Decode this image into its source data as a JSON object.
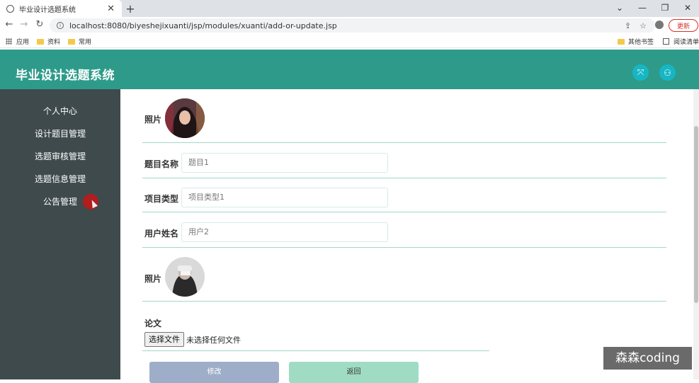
{
  "browser": {
    "tab_title": "毕业设计选题系统",
    "tab_close": "✕",
    "new_tab": "+",
    "url": "localhost:8080/biyeshejixuanti/jsp/modules/xuanti/add-or-update.jsp",
    "update_label": "更新",
    "window_controls": [
      "⌄",
      "—",
      "❐",
      "✕"
    ],
    "bookmarks": [
      {
        "label": "应用",
        "icon": "apps-grid-icon"
      },
      {
        "label": "资料",
        "icon": "folder-icon"
      },
      {
        "label": "常用",
        "icon": "folder-icon"
      }
    ],
    "bookmarks_right": [
      {
        "label": "其他书签",
        "icon": "folder-icon"
      },
      {
        "label": "阅读清单",
        "icon": "reading-list-icon"
      }
    ]
  },
  "app": {
    "title": "毕业设计选题系统",
    "header_icons": [
      "fullscreen-icon",
      "user-icon"
    ]
  },
  "sidebar": {
    "items": [
      {
        "label": "个人中心"
      },
      {
        "label": "设计题目管理"
      },
      {
        "label": "选题审核管理"
      },
      {
        "label": "选题信息管理"
      },
      {
        "label": "公告管理"
      }
    ]
  },
  "form": {
    "photo1_label": "照片",
    "topic_label": "题目名称",
    "topic_value": "题目1",
    "type_label": "项目类型",
    "type_value": "项目类型1",
    "user_label": "用户姓名",
    "user_value": "用户2",
    "photo2_label": "照片",
    "paper_label": "论文",
    "file_button": "选择文件",
    "file_status": "未选择任何文件",
    "submit_label": "修改",
    "back_label": "返回"
  },
  "watermark": "森森coding",
  "colors": {
    "header": "#2e9b8a",
    "sidebar": "#3f4a4d",
    "divider": "#9fd8cd",
    "submit_button": "#9eaec8",
    "back_button": "#9fdcc3",
    "header_icon": "#17b6c4"
  }
}
